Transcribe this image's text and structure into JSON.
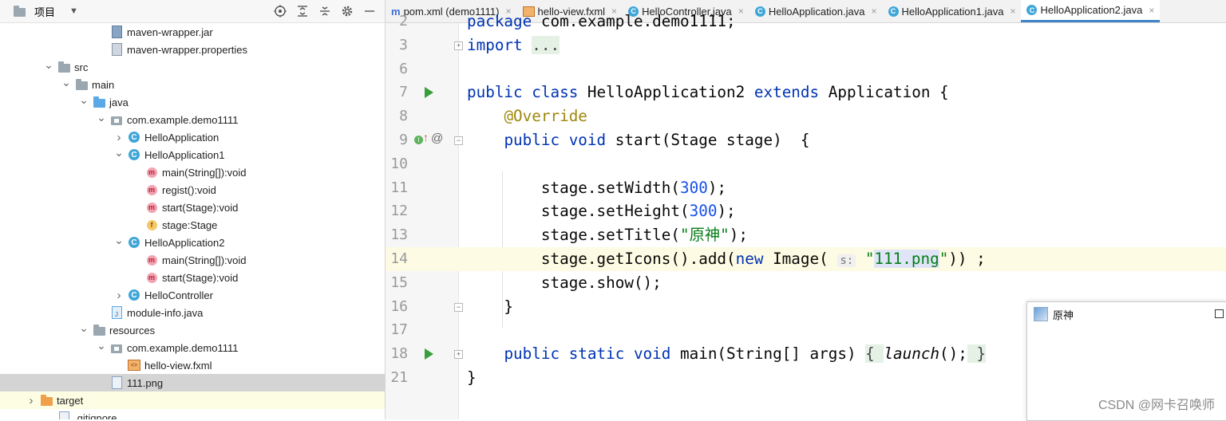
{
  "project_view": {
    "title": "项目",
    "items": [
      {
        "label": "maven-wrapper.jar",
        "icon": "jar",
        "indent": 5
      },
      {
        "label": "maven-wrapper.properties",
        "icon": "props",
        "indent": 5
      },
      {
        "label": "src",
        "icon": "folder",
        "indent": 2,
        "expanded": true
      },
      {
        "label": "main",
        "icon": "folder",
        "indent": 3,
        "expanded": true
      },
      {
        "label": "java",
        "icon": "folder-blue",
        "indent": 4,
        "expanded": true
      },
      {
        "label": "com.example.demo1111",
        "icon": "package",
        "indent": 5,
        "expanded": true
      },
      {
        "label": "HelloApplication",
        "icon": "class",
        "indent": 6,
        "expanded": false
      },
      {
        "label": "HelloApplication1",
        "icon": "class",
        "indent": 6,
        "expanded": true
      },
      {
        "label": "main(String[]):void",
        "icon": "method",
        "indent": 7
      },
      {
        "label": "regist():void",
        "icon": "method",
        "indent": 7
      },
      {
        "label": "start(Stage):void",
        "icon": "method",
        "indent": 7
      },
      {
        "label": "stage:Stage",
        "icon": "field",
        "indent": 7
      },
      {
        "label": "HelloApplication2",
        "icon": "class",
        "indent": 6,
        "expanded": true
      },
      {
        "label": "main(String[]):void",
        "icon": "method",
        "indent": 7
      },
      {
        "label": "start(Stage):void",
        "icon": "method",
        "indent": 7
      },
      {
        "label": "HelloController",
        "icon": "class",
        "indent": 6,
        "expanded": false
      },
      {
        "label": "module-info.java",
        "icon": "jfile",
        "indent": 5
      },
      {
        "label": "resources",
        "icon": "folder-res",
        "indent": 4,
        "expanded": true
      },
      {
        "label": "com.example.demo1111",
        "icon": "package",
        "indent": 5,
        "expanded": true
      },
      {
        "label": "hello-view.fxml",
        "icon": "fxml",
        "indent": 6
      },
      {
        "label": "111.png",
        "icon": "file",
        "indent": 5,
        "selected": true
      },
      {
        "label": "target",
        "icon": "folder-orange",
        "indent": 1,
        "expanded": false,
        "cursor": true
      },
      {
        "label": ".gitignore",
        "icon": "file",
        "indent": 2
      }
    ]
  },
  "tabs": [
    {
      "label": "pom.xml (demo1111)",
      "icon": "m"
    },
    {
      "label": "hello-view.fxml",
      "icon": "fxml"
    },
    {
      "label": "HelloController.java",
      "icon": "c"
    },
    {
      "label": "HelloApplication.java",
      "icon": "c"
    },
    {
      "label": "HelloApplication1.java",
      "icon": "c"
    },
    {
      "label": "HelloApplication2.java",
      "icon": "c",
      "active": true
    }
  ],
  "editor": {
    "lines": [
      {
        "n": "2",
        "html": "<span class='kw'>package</span> com.example.demo1111;"
      },
      {
        "n": "3",
        "html": "<span class='kw'>import</span> <span class='fold'>...</span>"
      },
      {
        "n": "6",
        "html": ""
      },
      {
        "n": "7",
        "html": "<span class='kw'>public class</span> HelloApplication2 <span class='kw'>extends</span> Application {"
      },
      {
        "n": "8",
        "html": "    <span class='an'>@Override</span>"
      },
      {
        "n": "9",
        "html": "    <span class='kw'>public void</span> start(Stage stage)  {"
      },
      {
        "n": "10",
        "html": ""
      },
      {
        "n": "11",
        "html": "        stage.setWidth(<span class='num'>300</span>);"
      },
      {
        "n": "12",
        "html": "        stage.setHeight(<span class='num'>300</span>);"
      },
      {
        "n": "13",
        "html": "        stage.setTitle(<span class='str'>\"原神\"</span>);"
      },
      {
        "n": "14",
        "html": "        stage.getIcons().add(<span class='kw'>new</span> Image( <span class='hint'>s:</span> <span class='str'>\"<span class='hl'>111.png</span>\"</span>)) ;"
      },
      {
        "n": "15",
        "html": "        stage.show();"
      },
      {
        "n": "16",
        "html": "    }"
      },
      {
        "n": "17",
        "html": ""
      },
      {
        "n": "18",
        "html": "    <span class='kw'>public static void</span> main(String[] args) <span class='fold'>{ </span><i>launch</i>();<span class='fold'> }</span>"
      },
      {
        "n": "21",
        "html": "}"
      }
    ]
  },
  "popup": {
    "title": "原神"
  },
  "watermark": "CSDN @网卡召唤师"
}
